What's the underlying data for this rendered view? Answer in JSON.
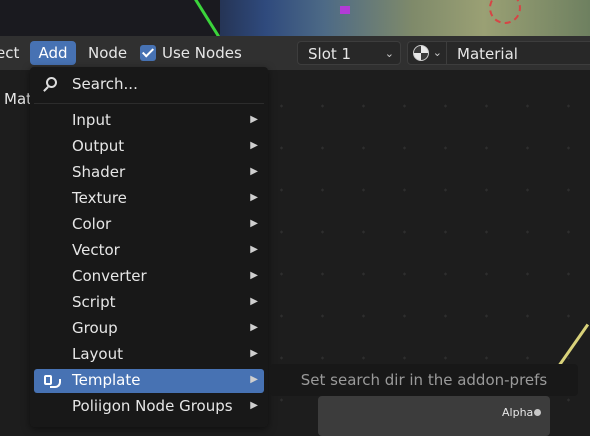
{
  "header": {
    "select_label": "Select",
    "add_label": "Add",
    "node_label": "Node",
    "use_nodes_label": "Use Nodes",
    "use_nodes_checked": true,
    "slot_value": "Slot 1",
    "material_name": "Material"
  },
  "editor": {
    "material_overlay": "Material",
    "socket_label": "Alpha"
  },
  "menu": {
    "search_label": "Search...",
    "items": [
      {
        "label": "Input",
        "submenu": true
      },
      {
        "label": "Output",
        "submenu": true
      },
      {
        "label": "Shader",
        "submenu": true
      },
      {
        "label": "Texture",
        "submenu": true
      },
      {
        "label": "Color",
        "submenu": true
      },
      {
        "label": "Vector",
        "submenu": true
      },
      {
        "label": "Converter",
        "submenu": true
      },
      {
        "label": "Script",
        "submenu": true
      },
      {
        "label": "Group",
        "submenu": true
      },
      {
        "label": "Layout",
        "submenu": true
      },
      {
        "label": "Template",
        "submenu": true,
        "active": true,
        "icon": "template-plug-icon"
      },
      {
        "label": "Poliigon Node Groups",
        "submenu": true
      }
    ],
    "arrow_glyph": "▶"
  },
  "tooltip": {
    "text": "Set search dir in the addon-prefs"
  },
  "colors": {
    "accent": "#4772b3",
    "menu_bg": "#181818",
    "header_bg": "#303030",
    "editor_bg": "#1d1d1d"
  }
}
